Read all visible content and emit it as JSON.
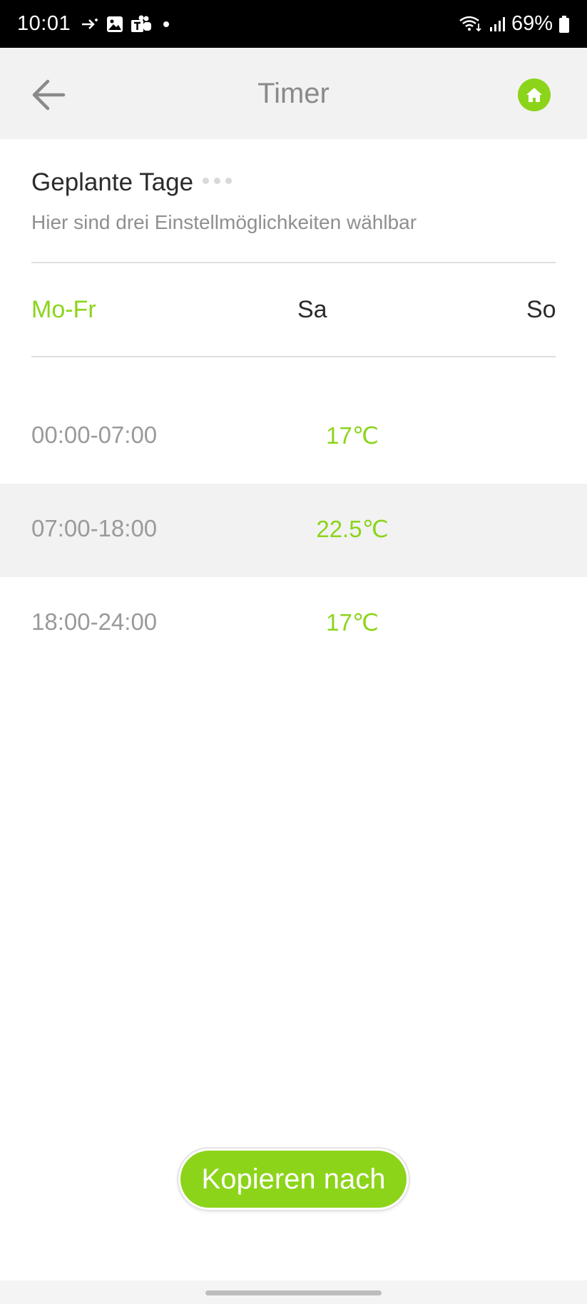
{
  "status_bar": {
    "time": "10:01",
    "battery": "69%",
    "icons_left": [
      "call-forward-icon",
      "image-icon",
      "teams-icon",
      "dot"
    ],
    "icons_right": [
      "wifi-icon",
      "signal-icon",
      "battery-icon"
    ]
  },
  "header": {
    "title": "Timer",
    "back_icon": "arrow-left-icon",
    "home_icon": "home-icon",
    "accent_color": "#8cd41a"
  },
  "section": {
    "title": "Geplante Tage",
    "subtitle": "Hier sind drei Einstellmöglichkeiten wählbar"
  },
  "tabs": [
    {
      "label": "Mo-Fr",
      "active": true
    },
    {
      "label": "Sa",
      "active": false
    },
    {
      "label": "So",
      "active": false
    }
  ],
  "schedule": [
    {
      "time": "00:00-07:00",
      "temp": "17℃"
    },
    {
      "time": "07:00-18:00",
      "temp": "22.5℃"
    },
    {
      "time": "18:00-24:00",
      "temp": "17℃"
    }
  ],
  "copy_button": {
    "label": "Kopieren nach"
  }
}
